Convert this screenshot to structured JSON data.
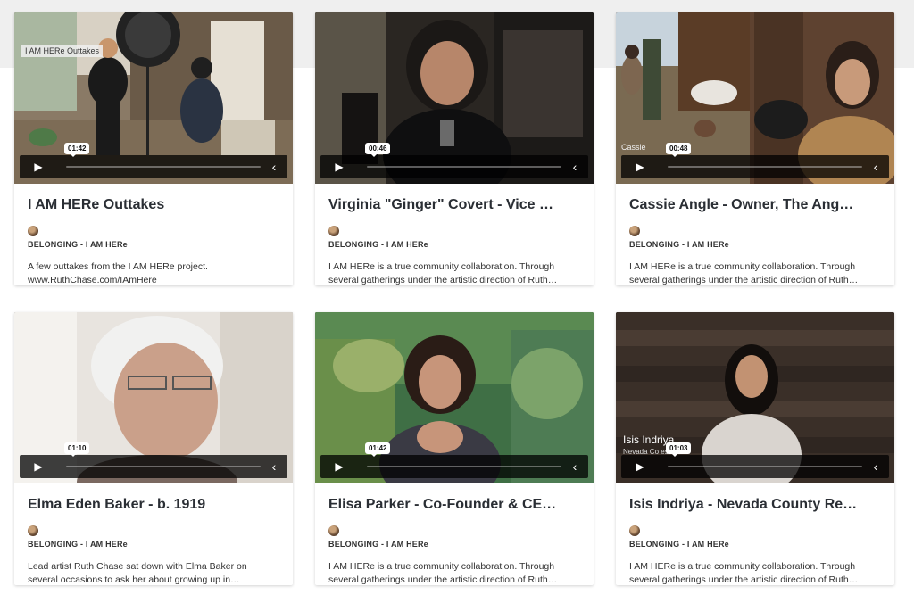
{
  "cards": [
    {
      "title": "I AM HERe Outtakes",
      "channel": "BELONGING - I AM HERe",
      "duration": "01:42",
      "description": "A few outtakes from the I AM HERe project.\nwww.RuthChase.com/IAmHere",
      "video_tagline": "I AM HERe Outtakes"
    },
    {
      "title": "Virginia \"Ginger\" Covert - Vice …",
      "channel": "BELONGING - I AM HERe",
      "duration": "00:46",
      "description": "I AM HERe is a true community collaboration. Through\nseveral gatherings under the artistic direction of Ruth…"
    },
    {
      "title": "Cassie Angle - Owner, The Ang…",
      "channel": "BELONGING - I AM HERe",
      "duration": "00:48",
      "description": "I AM HERe is a true community collaboration. Through\nseveral gatherings under the artistic direction of Ruth…",
      "video_overlay": "Cassie"
    },
    {
      "title": "Elma Eden Baker - b. 1919",
      "channel": "BELONGING - I AM HERe",
      "duration": "01:10",
      "description": "Lead artist Ruth Chase sat down with Elma Baker on\nseveral occasions to ask her about growing up in…"
    },
    {
      "title": "Elisa Parker - Co-Founder & CE…",
      "channel": "BELONGING - I AM HERe",
      "duration": "01:42",
      "description": "I AM HERe is a true community collaboration. Through\nseveral gatherings under the artistic direction of Ruth…"
    },
    {
      "title": "Isis Indriya - Nevada County Re…",
      "channel": "BELONGING - I AM HERe",
      "duration": "01:03",
      "description": "I AM HERe is a true community collaboration. Through\nseveral gatherings under the artistic direction of Ruth…",
      "video_overlay_name": "Isis Indriya",
      "video_overlay_subtitle": "Nevada Co     esident"
    }
  ],
  "icons": {
    "play": "play-icon",
    "collapse": "chevron-left-icon",
    "avatar": "channel-avatar"
  }
}
